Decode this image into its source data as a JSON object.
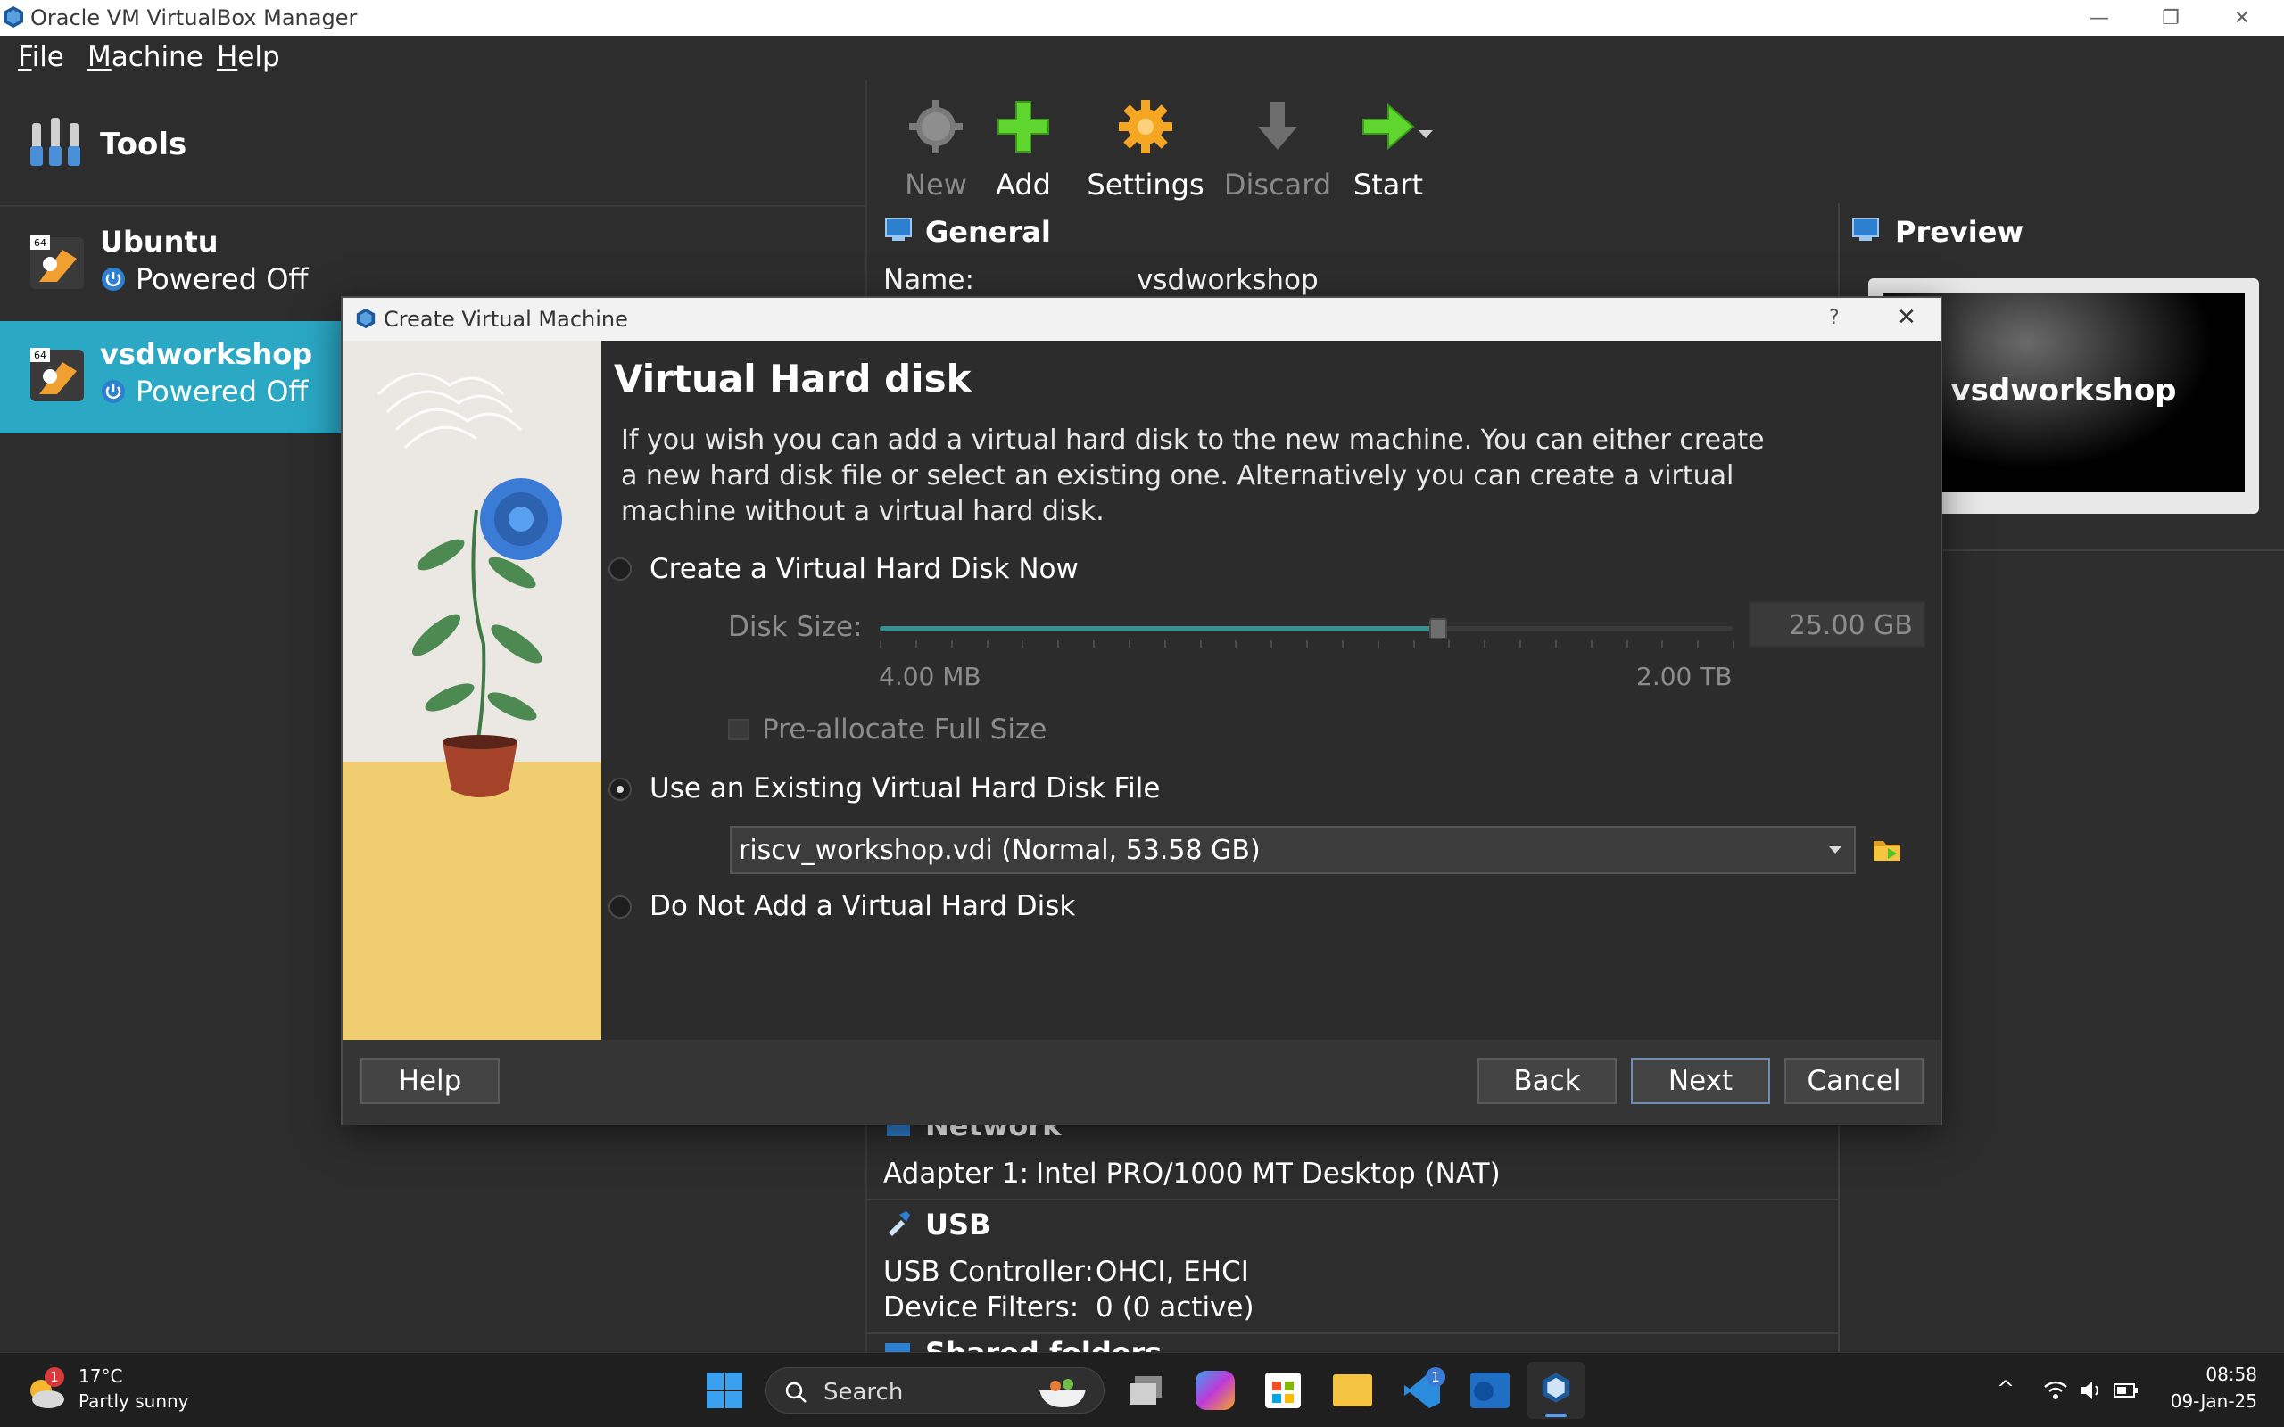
{
  "window": {
    "title": "Oracle VM VirtualBox Manager",
    "minimize": "—",
    "restore": "❐",
    "close": "✕"
  },
  "menu": [
    {
      "label": "File"
    },
    {
      "label": "Machine"
    },
    {
      "label": "Help"
    }
  ],
  "sidebar": {
    "tools_label": "Tools",
    "vms": [
      {
        "name": "Ubuntu",
        "state": "Powered Off",
        "badge": "64"
      },
      {
        "name": "vsdworkshop",
        "state": "Powered Off",
        "badge": "64"
      }
    ]
  },
  "toolbar": {
    "new": "New",
    "add": "Add",
    "settings": "Settings",
    "discard": "Discard",
    "start": "Start"
  },
  "details": {
    "general_title": "General",
    "name_key": "Name:",
    "name_value": "vsdworkshop",
    "network_title": "Network",
    "adapter_key": "Adapter 1:",
    "adapter_value": "Intel PRO/1000 MT Desktop (NAT)",
    "usb_title": "USB",
    "usb_controller_key": "USB Controller:",
    "usb_controller_value": "OHCI, EHCI",
    "device_filters_key": "Device Filters:",
    "device_filters_value": "0 (0 active)",
    "shared_title": "Shared folders"
  },
  "preview": {
    "title": "Preview",
    "vm_name": "vsdworkshop"
  },
  "dialog": {
    "title": "Create Virtual Machine",
    "help_glyph": "?",
    "close_glyph": "✕",
    "page_title": "Virtual Hard disk",
    "description": "If you wish you can add a virtual hard disk to the new machine. You can either create a new hard disk file or select an existing one. Alternatively you can create a virtual machine without a virtual hard disk.",
    "options": {
      "create_now": "Create a Virtual Hard Disk Now",
      "use_existing": "Use an Existing Virtual Hard Disk File",
      "do_not_add": "Do Not Add a Virtual Hard Disk"
    },
    "selected_option": "use_existing",
    "disk_size_label": "Disk Size:",
    "disk_size_value": "25.00 GB",
    "slider_min": "4.00 MB",
    "slider_max": "2.00 TB",
    "slider_fraction": 0.655,
    "preallocate_label": "Pre-allocate Full Size",
    "preallocate_checked": false,
    "existing_file": "riscv_workshop.vdi (Normal, 53.58 GB)",
    "buttons": {
      "help": "Help",
      "back": "Back",
      "next": "Next",
      "cancel": "Cancel"
    }
  },
  "taskbar": {
    "weather_temp": "17°C",
    "weather_desc": "Partly sunny",
    "weather_badge": "1",
    "search_placeholder": "Search",
    "app_badge": "1",
    "time": "08:58",
    "date": "09-Jan-25"
  },
  "colors": {
    "accent_selected": "#2aa8c4",
    "slider_fill": "#3b8f8f",
    "add_green": "#5fd62e",
    "settings_orange": "#f5a623"
  }
}
